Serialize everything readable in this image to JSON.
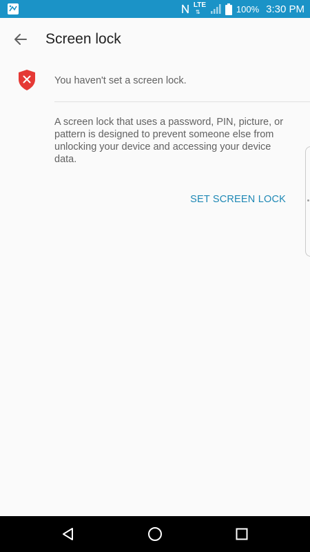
{
  "status_bar": {
    "network_type": "LTE",
    "battery": "100%",
    "time": "3:30 PM",
    "icons": [
      "app-notification-icon",
      "nfc-icon",
      "lte-icon",
      "signal-icon",
      "battery-icon"
    ],
    "color": "#1b93c7"
  },
  "header": {
    "title": "Screen lock",
    "back_icon": "arrow-back-icon"
  },
  "warning": {
    "icon": "shield-x-icon",
    "icon_color": "#e53935",
    "text": "You haven't set a screen lock."
  },
  "description": "A screen lock that uses a password, PIN, picture, or pattern is designed to prevent someone else from unlocking your device and accessing your device data.",
  "action": {
    "label": "SET SCREEN LOCK",
    "color": "#1e88b5"
  },
  "nav_bar": {
    "icons": [
      "nav-back-icon",
      "nav-home-icon",
      "nav-recents-icon"
    ]
  }
}
